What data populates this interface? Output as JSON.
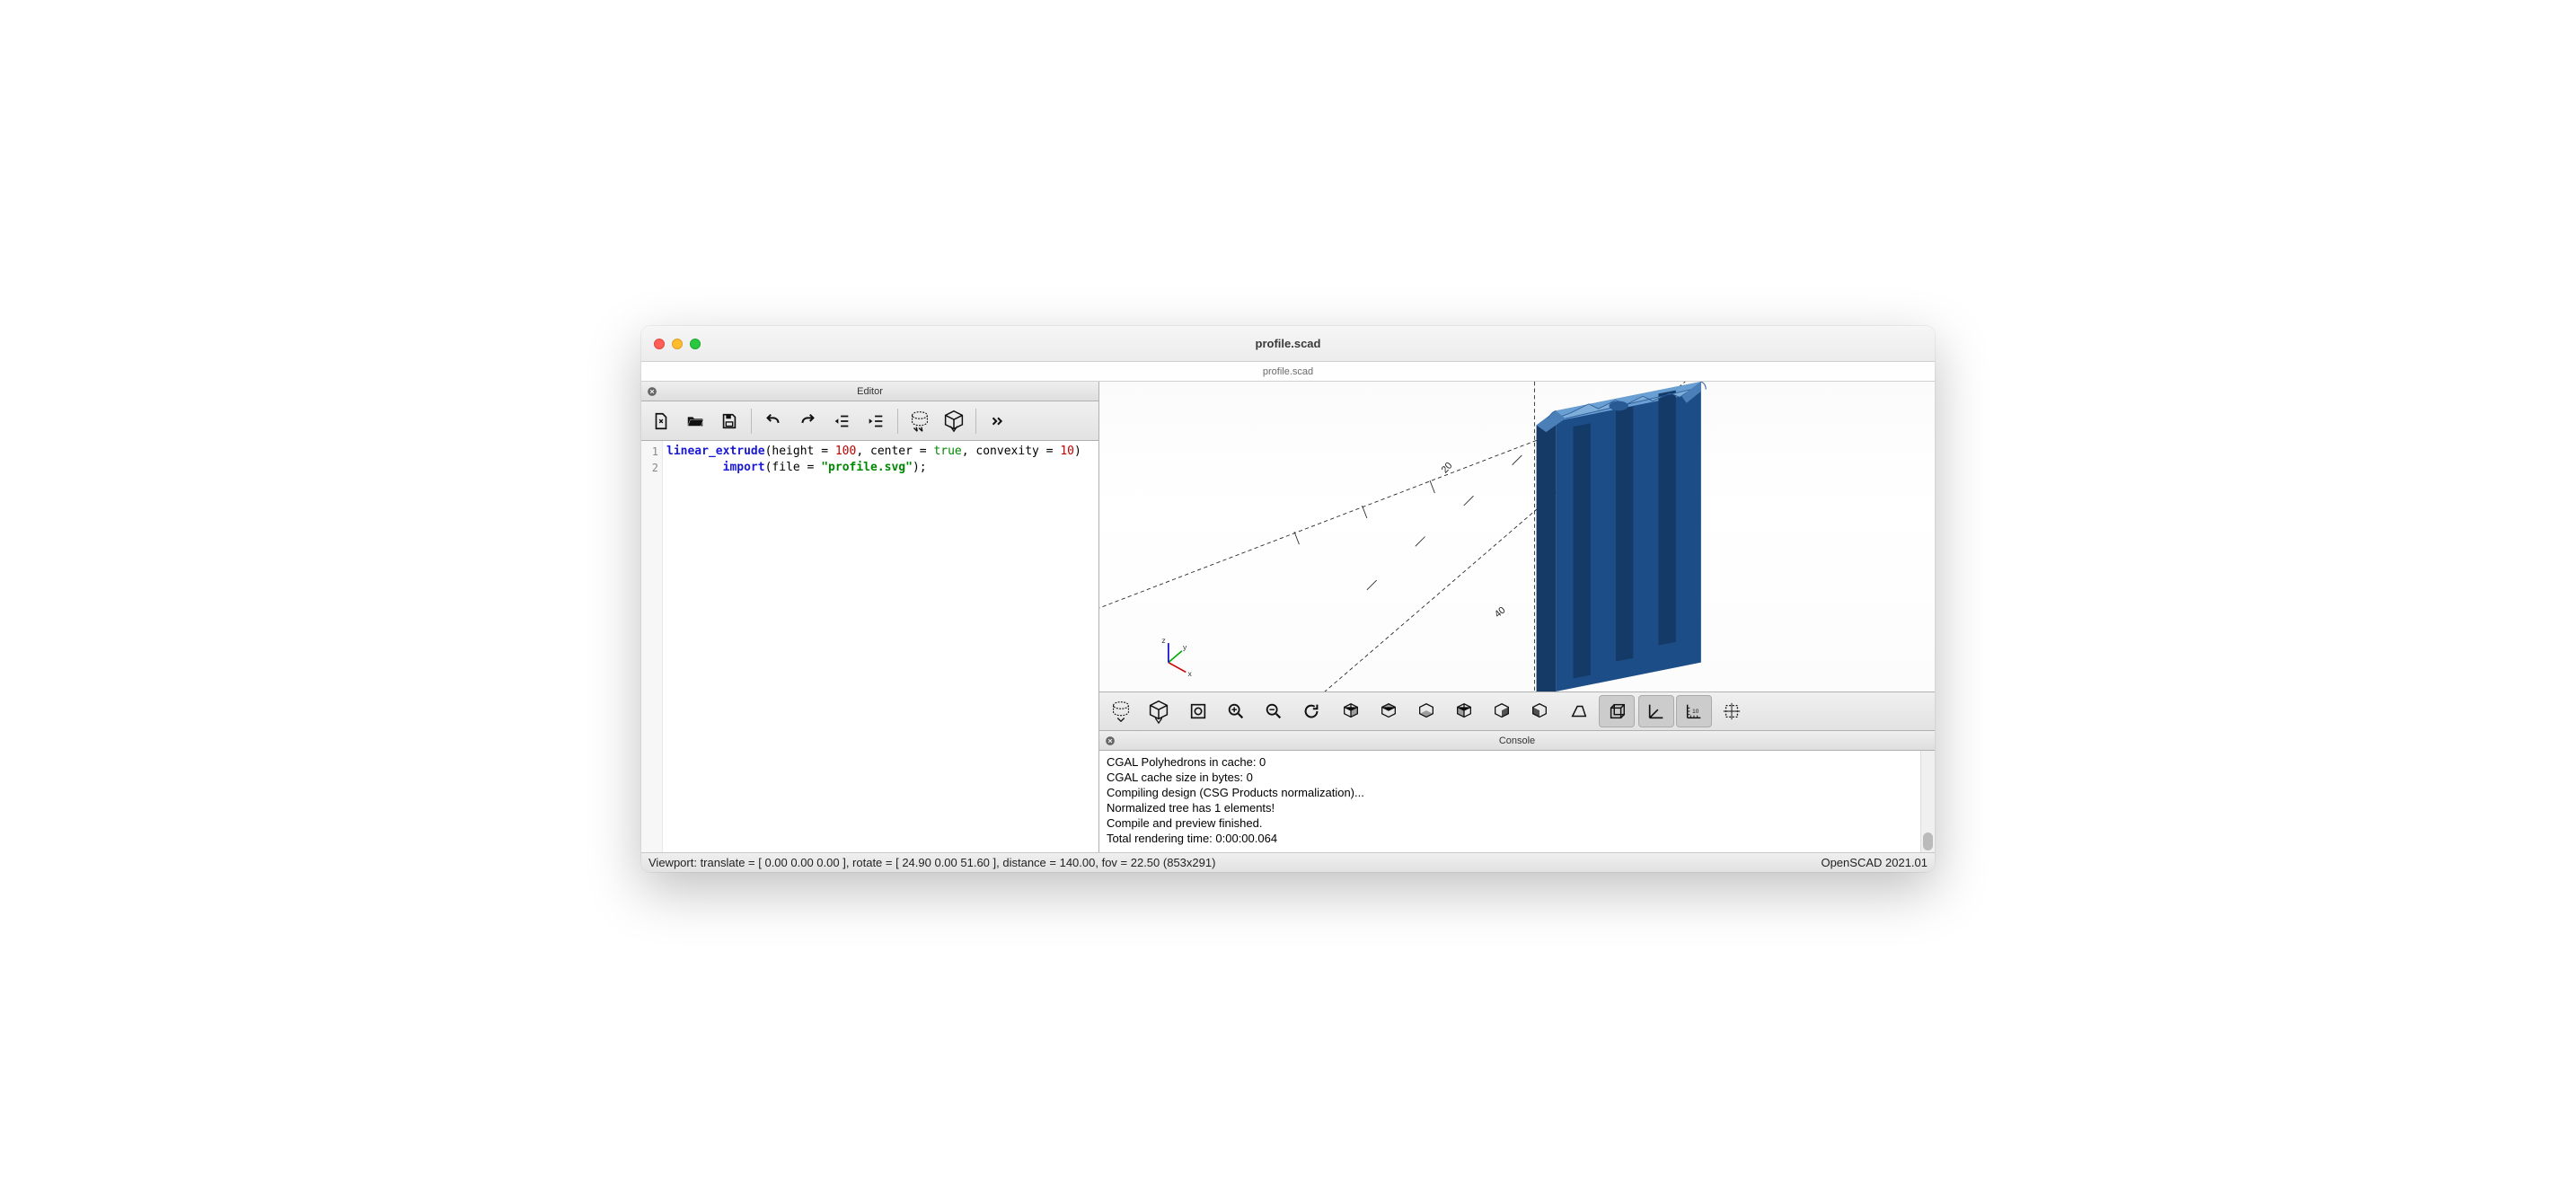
{
  "window": {
    "title": "profile.scad",
    "tab": "profile.scad"
  },
  "editor_panel": {
    "title": "Editor",
    "lines": [
      "1",
      "2"
    ],
    "code": {
      "l1_fn1": "linear_extrude",
      "l1_arg1": "height = ",
      "l1_num1": "100",
      "l1_arg2": ", center = ",
      "l1_bool": "true",
      "l1_arg3": ", convexity = ",
      "l1_num2": "10",
      "l2_fn": "import",
      "l2_arg": "file = ",
      "l2_str": "\"profile.svg\"",
      "l2_end": ");"
    }
  },
  "console_panel": {
    "title": "Console",
    "lines": [
      "CGAL Polyhedrons in cache: 0",
      "CGAL cache size in bytes: 0",
      "Compiling design (CSG Products normalization)...",
      "Normalized tree has 1 elements!",
      "Compile and preview finished.",
      "Total rendering time: 0:00:00.064"
    ]
  },
  "statusbar": {
    "left": "Viewport: translate = [ 0.00 0.00 0.00 ], rotate = [ 24.90 0.00 51.60 ], distance = 140.00, fov = 22.50 (853x291)",
    "right": "OpenSCAD 2021.01"
  },
  "viewport": {
    "ticks": [
      "20",
      "40",
      "20"
    ]
  }
}
